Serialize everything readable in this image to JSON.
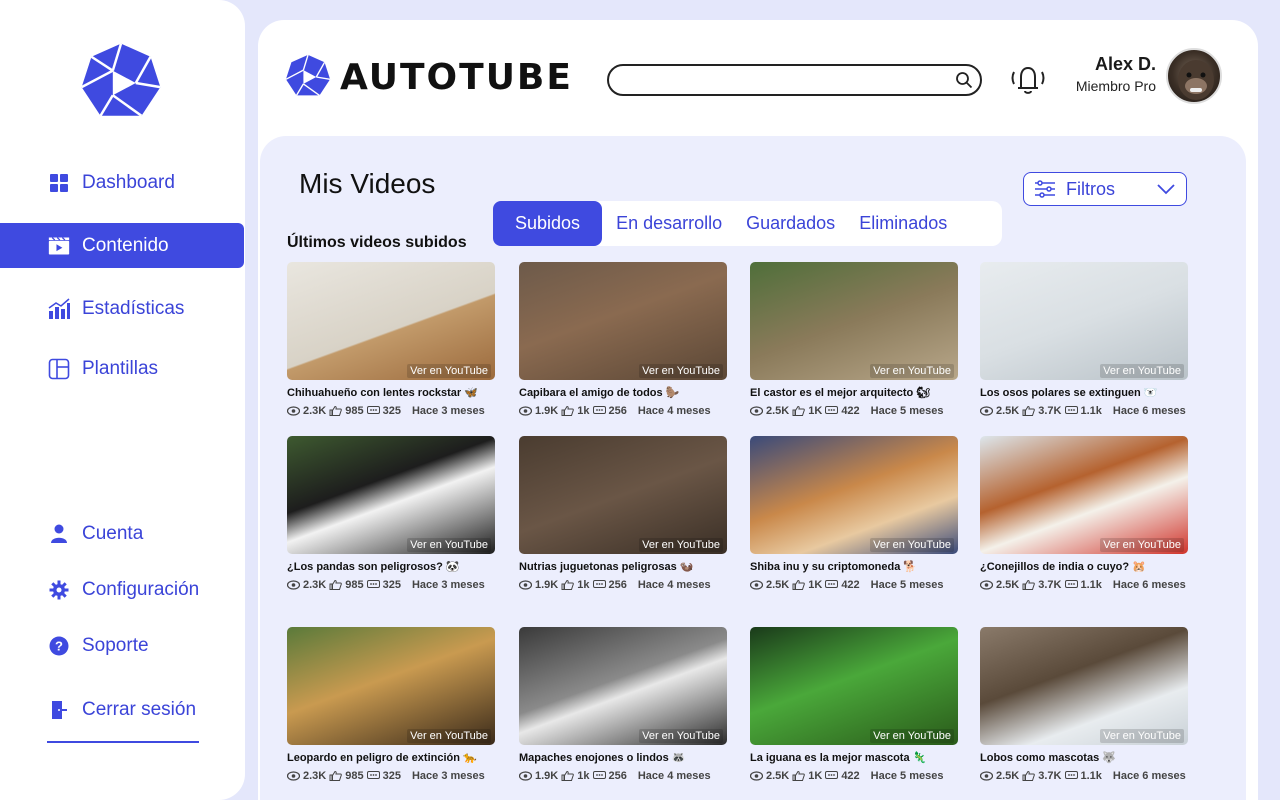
{
  "app": {
    "brand": "AUTOTUBE"
  },
  "colors": {
    "accent": "#3f4ae0",
    "background": "#e4e7fb",
    "content_bg": "#eceefd"
  },
  "sidebar": {
    "items": [
      {
        "label": "Dashboard",
        "icon": "grid-icon"
      },
      {
        "label": "Contenido",
        "icon": "video-clapper-icon",
        "active": true
      },
      {
        "label": "Estadísticas",
        "icon": "bar-chart-icon"
      },
      {
        "label": "Plantillas",
        "icon": "template-icon"
      }
    ],
    "bottom_items": [
      {
        "label": "Cuenta",
        "icon": "user-icon"
      },
      {
        "label": "Configuración",
        "icon": "gear-icon"
      },
      {
        "label": "Soporte",
        "icon": "help-icon"
      },
      {
        "label": "Cerrar sesión",
        "icon": "logout-icon"
      }
    ]
  },
  "header": {
    "search": {
      "value": "",
      "placeholder": ""
    },
    "user": {
      "name": "Alex D.",
      "role": "Miembro Pro"
    }
  },
  "main": {
    "title": "Mis Videos",
    "filters_label": "Filtros",
    "tabs": [
      {
        "label": "Subidos",
        "active": true
      },
      {
        "label": "En desarrollo"
      },
      {
        "label": "Guardados"
      },
      {
        "label": "Eliminados"
      }
    ],
    "section_title": "Últimos videos subidos",
    "watch_label": "Ver en YouTube",
    "videos": [
      {
        "title": "Chihuahueño con lentes rockstar 🦋",
        "views": "2.3K",
        "likes": "985",
        "comments": "325",
        "ago": "Hace 3 meses"
      },
      {
        "title": "Capibara el amigo de todos 🦫",
        "views": "1.9K",
        "likes": "1k",
        "comments": "256",
        "ago": "Hace 4 meses"
      },
      {
        "title": "El castor es el mejor arquitecto 🐿",
        "views": "2.5K",
        "likes": "1K",
        "comments": "422",
        "ago": "Hace 5 meses"
      },
      {
        "title": "Los osos polares se extinguen 🐻‍❄️",
        "views": "2.5K",
        "likes": "3.7K",
        "comments": "1.1k",
        "ago": "Hace 6 meses"
      },
      {
        "title": "¿Los pandas son peligrosos? 🐼",
        "views": "2.3K",
        "likes": "985",
        "comments": "325",
        "ago": "Hace 3 meses"
      },
      {
        "title": "Nutrias juguetonas peligrosas 🦦",
        "views": "1.9K",
        "likes": "1k",
        "comments": "256",
        "ago": "Hace 4 meses"
      },
      {
        "title": "Shiba inu y su criptomoneda 🐕",
        "views": "2.5K",
        "likes": "1K",
        "comments": "422",
        "ago": "Hace 5 meses"
      },
      {
        "title": "¿Conejillos de india o cuyo? 🐹",
        "views": "2.5K",
        "likes": "3.7K",
        "comments": "1.1k",
        "ago": "Hace 6 meses"
      },
      {
        "title": "Leopardo en peligro de extinción 🐆",
        "views": "2.3K",
        "likes": "985",
        "comments": "325",
        "ago": "Hace 3 meses"
      },
      {
        "title": "Mapaches enojones o lindos 🦝",
        "views": "1.9K",
        "likes": "1k",
        "comments": "256",
        "ago": "Hace 4 meses"
      },
      {
        "title": "La iguana es la mejor mascota 🦎",
        "views": "2.5K",
        "likes": "1K",
        "comments": "422",
        "ago": "Hace 5 meses"
      },
      {
        "title": "Lobos como mascotas 🐺",
        "views": "2.5K",
        "likes": "3.7K",
        "comments": "1.1k",
        "ago": "Hace 6 meses"
      }
    ]
  }
}
